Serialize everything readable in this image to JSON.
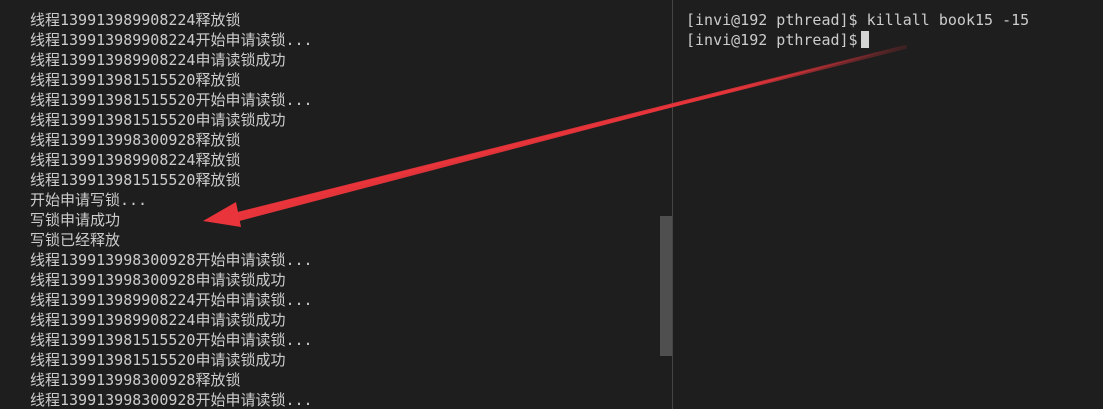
{
  "left_terminal": {
    "lines": [
      "线程139913989908224释放锁",
      "线程139913989908224开始申请读锁...",
      "线程139913989908224申请读锁成功",
      "线程139913981515520释放锁",
      "线程139913981515520开始申请读锁...",
      "线程139913981515520申请读锁成功",
      "线程139913998300928释放锁",
      "线程139913989908224释放锁",
      "线程139913981515520释放锁",
      "开始申请写锁...",
      "写锁申请成功",
      "写锁已经释放",
      "线程139913998300928开始申请读锁...",
      "线程139913998300928申请读锁成功",
      "线程139913989908224开始申请读锁...",
      "线程139913989908224申请读锁成功",
      "线程139913981515520开始申请读锁...",
      "线程139913981515520申请读锁成功",
      "线程139913998300928释放锁",
      "线程139913998300928开始申请读锁..."
    ]
  },
  "right_terminal": {
    "lines": [
      "[invi@192 pthread]$ killall book15 -15",
      "[invi@192 pthread]$"
    ]
  },
  "colors": {
    "background": "#1e1e1e",
    "text": "#cccccc",
    "arrow": "#e8343a",
    "divider": "#444444",
    "scrollbar": "#4f4f4f"
  },
  "icons": {
    "annotation": "red-arrow",
    "cursor": "block-cursor"
  }
}
